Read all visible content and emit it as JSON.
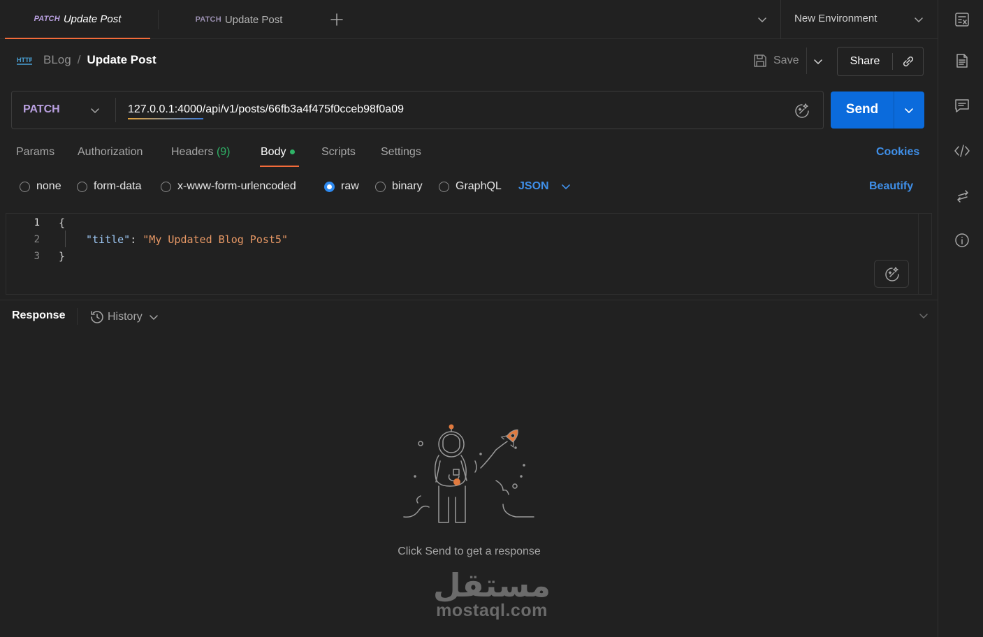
{
  "tabs": [
    {
      "method": "PATCH",
      "title": "Update Post",
      "active": true
    },
    {
      "method": "PATCH",
      "title": "Update Post",
      "active": false
    }
  ],
  "environment": {
    "label": "New Environment"
  },
  "breadcrumb": {
    "parent": "BLog",
    "separator": "/",
    "current": "Update Post"
  },
  "toolbar": {
    "save_label": "Save",
    "share_label": "Share"
  },
  "request": {
    "method": "PATCH",
    "url": "127.0.0.1:4000/api/v1/posts/66fb3a4f475f0cceb98f0a09",
    "send_label": "Send"
  },
  "request_tabs": {
    "params": "Params",
    "authorization": "Authorization",
    "headers": "Headers",
    "headers_count": "(9)",
    "body": "Body",
    "scripts": "Scripts",
    "settings": "Settings",
    "cookies": "Cookies"
  },
  "body_types": {
    "none": "none",
    "form_data": "form-data",
    "urlencoded": "x-www-form-urlencoded",
    "raw": "raw",
    "binary": "binary",
    "graphql": "GraphQL",
    "selected": "raw",
    "format": "JSON",
    "beautify": "Beautify"
  },
  "editor": {
    "line_numbers": [
      "1",
      "2",
      "3"
    ],
    "open_brace": "{",
    "key": "\"title\"",
    "colon": ": ",
    "value": "\"My Updated Blog Post5\"",
    "close_brace": "}"
  },
  "response": {
    "title": "Response",
    "history_label": "History",
    "empty_message": "Click Send to get a response"
  },
  "watermark": {
    "arabic": "مستقل",
    "latin": "mostaql.com"
  },
  "colors": {
    "background": "#212121",
    "accent_orange": "#f26b3a",
    "send_blue": "#0b6bdc",
    "link_blue": "#3f8fe8",
    "method_purple": "#b9a0e0",
    "json_key": "#9cc6f2",
    "json_string": "#e79865",
    "success_green": "#2fb367"
  },
  "icons": {
    "new_tab": "plus-icon",
    "tabs_menu": "chevron-down-icon",
    "environment_quick_look": "environment-icon",
    "http": "http-icon",
    "save": "floppy-disk-icon",
    "link": "link-icon",
    "ai_assist": "sparkle-icon",
    "docs": "document-icon",
    "comments": "comment-icon",
    "code": "code-icon",
    "related": "arrows-icon",
    "info": "info-icon",
    "history": "history-icon",
    "empty_state": "astronaut-rocket-illustration"
  }
}
